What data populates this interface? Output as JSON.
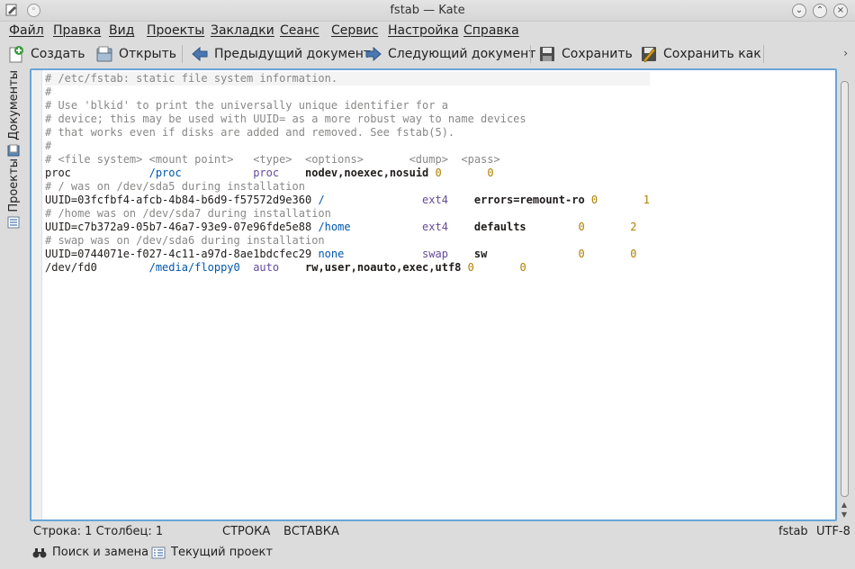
{
  "window": {
    "title": "fstab — Kate"
  },
  "menubar": {
    "items": [
      "Файл",
      "Правка",
      "Вид",
      "Проекты",
      "Закладки",
      "Сеанс",
      "Сервис",
      "Настройка",
      "Справка"
    ]
  },
  "toolbar": {
    "new_label": "Создать",
    "open_label": "Открыть",
    "prev_label": "Предыдущий документ",
    "next_label": "Следующий документ",
    "save_label": "Сохранить",
    "save_as_label": "Сохранить как",
    "more_glyph": "›"
  },
  "sidebar": {
    "documents_label": "Документы",
    "projects_label": "Проекты"
  },
  "editor": {
    "lines": [
      [
        {
          "t": "# /etc/fstab: static file system information.",
          "c": "cm"
        }
      ],
      [
        {
          "t": "#",
          "c": "cm"
        }
      ],
      [
        {
          "t": "# Use 'blkid' to print the universally unique identifier for a",
          "c": "cm"
        }
      ],
      [
        {
          "t": "# device; this may be used with UUID= as a more robust way to name devices",
          "c": "cm"
        }
      ],
      [
        {
          "t": "# that works even if disks are added and removed. See fstab(5).",
          "c": "cm"
        }
      ],
      [
        {
          "t": "#",
          "c": "cm"
        }
      ],
      [
        {
          "t": "# <file system> <mount point>   <type>  <options>       <dump>  <pass>",
          "c": "cm"
        }
      ],
      [
        {
          "t": "proc            ",
          "c": ""
        },
        {
          "t": "/proc",
          "c": "kw"
        },
        {
          "t": "           ",
          "c": ""
        },
        {
          "t": "proc",
          "c": "fs"
        },
        {
          "t": "    ",
          "c": ""
        },
        {
          "t": "nodev,noexec,nosuid",
          "c": "bold"
        },
        {
          "t": " ",
          "c": ""
        },
        {
          "t": "0",
          "c": "num"
        },
        {
          "t": "       ",
          "c": ""
        },
        {
          "t": "0",
          "c": "num"
        }
      ],
      [
        {
          "t": "# / was on /dev/sda5 during installation",
          "c": "cm"
        }
      ],
      [
        {
          "t": "UUID=03fcfbf4-afcb-4b84-b6d9-f57572d9e360 ",
          "c": ""
        },
        {
          "t": "/",
          "c": "kw"
        },
        {
          "t": "               ",
          "c": ""
        },
        {
          "t": "ext4",
          "c": "fs"
        },
        {
          "t": "    ",
          "c": ""
        },
        {
          "t": "errors=remount-ro",
          "c": "bold"
        },
        {
          "t": " ",
          "c": ""
        },
        {
          "t": "0",
          "c": "num"
        },
        {
          "t": "       ",
          "c": ""
        },
        {
          "t": "1",
          "c": "num"
        }
      ],
      [
        {
          "t": "# /home was on /dev/sda7 during installation",
          "c": "cm"
        }
      ],
      [
        {
          "t": "UUID=c7b372a9-05b7-46a7-93e9-07e96fde5e88 ",
          "c": ""
        },
        {
          "t": "/home",
          "c": "kw"
        },
        {
          "t": "           ",
          "c": ""
        },
        {
          "t": "ext4",
          "c": "fs"
        },
        {
          "t": "    ",
          "c": ""
        },
        {
          "t": "defaults",
          "c": "bold"
        },
        {
          "t": "        ",
          "c": ""
        },
        {
          "t": "0",
          "c": "num"
        },
        {
          "t": "       ",
          "c": ""
        },
        {
          "t": "2",
          "c": "num"
        }
      ],
      [
        {
          "t": "# swap was on /dev/sda6 during installation",
          "c": "cm"
        }
      ],
      [
        {
          "t": "UUID=0744071e-f027-4c11-a97d-8ae1bdcfec29 ",
          "c": ""
        },
        {
          "t": "none",
          "c": "kw"
        },
        {
          "t": "            ",
          "c": ""
        },
        {
          "t": "swap",
          "c": "fs"
        },
        {
          "t": "    ",
          "c": ""
        },
        {
          "t": "sw",
          "c": "bold"
        },
        {
          "t": "              ",
          "c": ""
        },
        {
          "t": "0",
          "c": "num"
        },
        {
          "t": "       ",
          "c": ""
        },
        {
          "t": "0",
          "c": "num"
        }
      ],
      [
        {
          "t": "/dev/fd0        ",
          "c": ""
        },
        {
          "t": "/media/floppy0",
          "c": "kw"
        },
        {
          "t": "  ",
          "c": ""
        },
        {
          "t": "auto",
          "c": "fs"
        },
        {
          "t": "    ",
          "c": ""
        },
        {
          "t": "rw,user,noauto,exec,utf8",
          "c": "bold"
        },
        {
          "t": " ",
          "c": ""
        },
        {
          "t": "0",
          "c": "num"
        },
        {
          "t": "       ",
          "c": ""
        },
        {
          "t": "0",
          "c": "num"
        }
      ]
    ]
  },
  "status": {
    "position": "Строка: 1 Столбец: 1",
    "mode": "СТРОКА",
    "insert": "ВСТАВКА",
    "filetype": "fstab",
    "encoding": "UTF-8"
  },
  "bottom": {
    "search_label": "Поиск и замена",
    "project_label": "Текущий проект"
  },
  "colors": {
    "focus_border": "#6aa5d8",
    "comment": "#898887",
    "keyword": "#0057ae",
    "number": "#b08000",
    "fstype": "#644a9b"
  }
}
